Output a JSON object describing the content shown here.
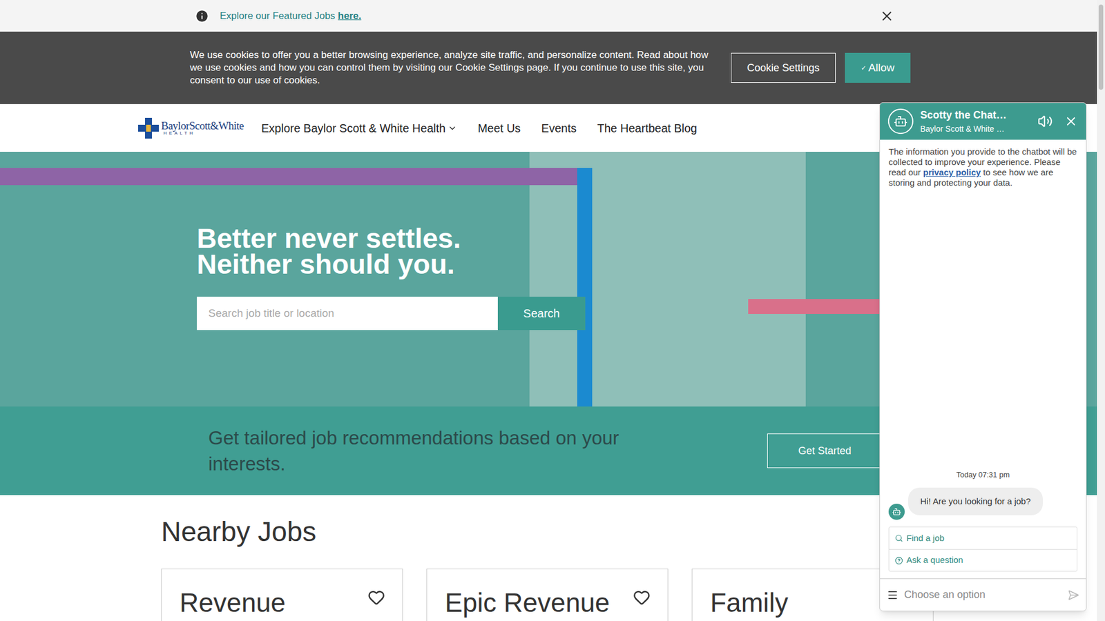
{
  "announcement": {
    "text": "Explore our Featured Jobs ",
    "link": "here."
  },
  "cookie_banner": {
    "text": "We use cookies to offer you a better browsing experience, analyze site traffic, and personalize content. Read about how we use cookies and how you can control them by visiting our Cookie Settings page. If you continue to use this site, you consent to our use of cookies.",
    "settings_button": "Cookie Settings",
    "allow_check": "✓",
    "allow_button": "Allow"
  },
  "nav": {
    "logo": {
      "name": "BaylorScott&White",
      "sub": "HEALTH"
    },
    "items": [
      {
        "label": "Explore Baylor Scott & White Health",
        "dropdown": true
      },
      {
        "label": "Meet Us",
        "dropdown": false
      },
      {
        "label": "Events",
        "dropdown": false
      },
      {
        "label": "The Heartbeat Blog",
        "dropdown": false
      }
    ]
  },
  "hero": {
    "headline": [
      "Better never settles.",
      "Neither should you."
    ],
    "search_placeholder": "Search job title or location",
    "search_button": "Search"
  },
  "recommendations": {
    "text": "Get tailored job recommendations based on your interests.",
    "button": "Get Started"
  },
  "nearby_jobs": {
    "title": "Nearby Jobs",
    "cards": [
      {
        "title": "Revenue",
        "favorite": false
      },
      {
        "title": "Epic Revenue",
        "favorite": false
      },
      {
        "title": "Family",
        "favorite": false
      }
    ]
  },
  "chatbot": {
    "title": "Scotty the Chat…",
    "subtitle": "Baylor Scott & White …",
    "muted": false,
    "privacy": {
      "before": "The information you provide to the chatbot will be collected to improve your experience. Please read our ",
      "link": "privacy policy",
      "after": " to see how we are storing and protecting your data."
    },
    "timestamp": "Today 07:31 pm",
    "message": "Hi! Are you looking for a job?",
    "options": [
      {
        "label": "Find a job",
        "kind": "search"
      },
      {
        "label": "Ask a question",
        "kind": "question"
      }
    ],
    "input_placeholder": "Choose an option"
  }
}
